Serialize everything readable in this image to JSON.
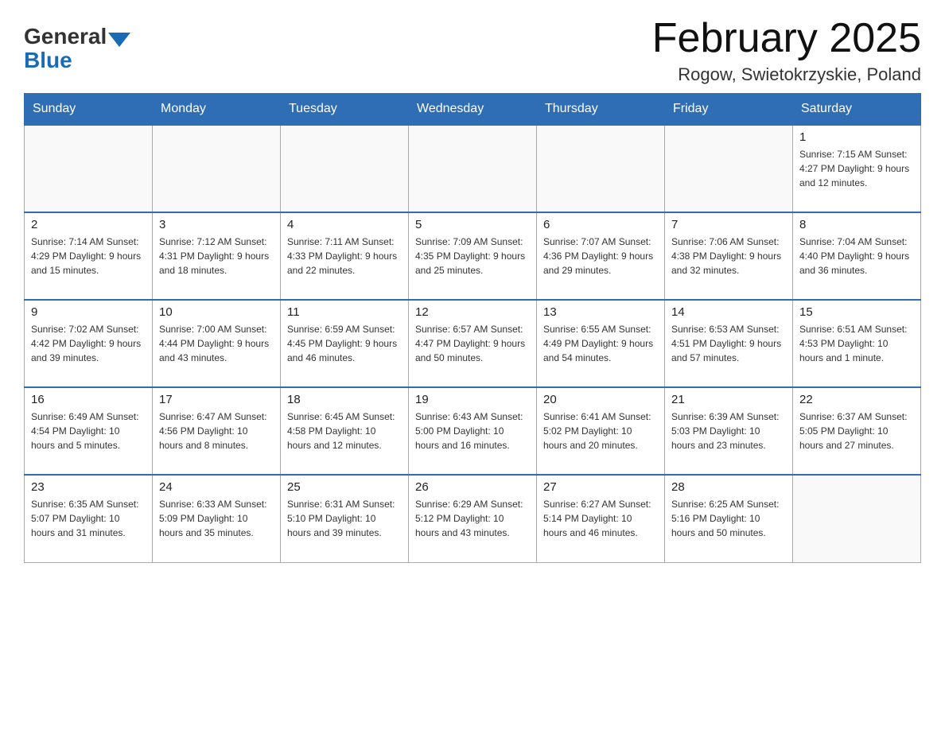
{
  "header": {
    "logo_general": "General",
    "logo_blue": "Blue",
    "title": "February 2025",
    "subtitle": "Rogow, Swietokrzyskie, Poland"
  },
  "days_of_week": [
    "Sunday",
    "Monday",
    "Tuesday",
    "Wednesday",
    "Thursday",
    "Friday",
    "Saturday"
  ],
  "weeks": [
    [
      {
        "day": "",
        "info": ""
      },
      {
        "day": "",
        "info": ""
      },
      {
        "day": "",
        "info": ""
      },
      {
        "day": "",
        "info": ""
      },
      {
        "day": "",
        "info": ""
      },
      {
        "day": "",
        "info": ""
      },
      {
        "day": "1",
        "info": "Sunrise: 7:15 AM\nSunset: 4:27 PM\nDaylight: 9 hours and 12 minutes."
      }
    ],
    [
      {
        "day": "2",
        "info": "Sunrise: 7:14 AM\nSunset: 4:29 PM\nDaylight: 9 hours and 15 minutes."
      },
      {
        "day": "3",
        "info": "Sunrise: 7:12 AM\nSunset: 4:31 PM\nDaylight: 9 hours and 18 minutes."
      },
      {
        "day": "4",
        "info": "Sunrise: 7:11 AM\nSunset: 4:33 PM\nDaylight: 9 hours and 22 minutes."
      },
      {
        "day": "5",
        "info": "Sunrise: 7:09 AM\nSunset: 4:35 PM\nDaylight: 9 hours and 25 minutes."
      },
      {
        "day": "6",
        "info": "Sunrise: 7:07 AM\nSunset: 4:36 PM\nDaylight: 9 hours and 29 minutes."
      },
      {
        "day": "7",
        "info": "Sunrise: 7:06 AM\nSunset: 4:38 PM\nDaylight: 9 hours and 32 minutes."
      },
      {
        "day": "8",
        "info": "Sunrise: 7:04 AM\nSunset: 4:40 PM\nDaylight: 9 hours and 36 minutes."
      }
    ],
    [
      {
        "day": "9",
        "info": "Sunrise: 7:02 AM\nSunset: 4:42 PM\nDaylight: 9 hours and 39 minutes."
      },
      {
        "day": "10",
        "info": "Sunrise: 7:00 AM\nSunset: 4:44 PM\nDaylight: 9 hours and 43 minutes."
      },
      {
        "day": "11",
        "info": "Sunrise: 6:59 AM\nSunset: 4:45 PM\nDaylight: 9 hours and 46 minutes."
      },
      {
        "day": "12",
        "info": "Sunrise: 6:57 AM\nSunset: 4:47 PM\nDaylight: 9 hours and 50 minutes."
      },
      {
        "day": "13",
        "info": "Sunrise: 6:55 AM\nSunset: 4:49 PM\nDaylight: 9 hours and 54 minutes."
      },
      {
        "day": "14",
        "info": "Sunrise: 6:53 AM\nSunset: 4:51 PM\nDaylight: 9 hours and 57 minutes."
      },
      {
        "day": "15",
        "info": "Sunrise: 6:51 AM\nSunset: 4:53 PM\nDaylight: 10 hours and 1 minute."
      }
    ],
    [
      {
        "day": "16",
        "info": "Sunrise: 6:49 AM\nSunset: 4:54 PM\nDaylight: 10 hours and 5 minutes."
      },
      {
        "day": "17",
        "info": "Sunrise: 6:47 AM\nSunset: 4:56 PM\nDaylight: 10 hours and 8 minutes."
      },
      {
        "day": "18",
        "info": "Sunrise: 6:45 AM\nSunset: 4:58 PM\nDaylight: 10 hours and 12 minutes."
      },
      {
        "day": "19",
        "info": "Sunrise: 6:43 AM\nSunset: 5:00 PM\nDaylight: 10 hours and 16 minutes."
      },
      {
        "day": "20",
        "info": "Sunrise: 6:41 AM\nSunset: 5:02 PM\nDaylight: 10 hours and 20 minutes."
      },
      {
        "day": "21",
        "info": "Sunrise: 6:39 AM\nSunset: 5:03 PM\nDaylight: 10 hours and 23 minutes."
      },
      {
        "day": "22",
        "info": "Sunrise: 6:37 AM\nSunset: 5:05 PM\nDaylight: 10 hours and 27 minutes."
      }
    ],
    [
      {
        "day": "23",
        "info": "Sunrise: 6:35 AM\nSunset: 5:07 PM\nDaylight: 10 hours and 31 minutes."
      },
      {
        "day": "24",
        "info": "Sunrise: 6:33 AM\nSunset: 5:09 PM\nDaylight: 10 hours and 35 minutes."
      },
      {
        "day": "25",
        "info": "Sunrise: 6:31 AM\nSunset: 5:10 PM\nDaylight: 10 hours and 39 minutes."
      },
      {
        "day": "26",
        "info": "Sunrise: 6:29 AM\nSunset: 5:12 PM\nDaylight: 10 hours and 43 minutes."
      },
      {
        "day": "27",
        "info": "Sunrise: 6:27 AM\nSunset: 5:14 PM\nDaylight: 10 hours and 46 minutes."
      },
      {
        "day": "28",
        "info": "Sunrise: 6:25 AM\nSunset: 5:16 PM\nDaylight: 10 hours and 50 minutes."
      },
      {
        "day": "",
        "info": ""
      }
    ]
  ]
}
